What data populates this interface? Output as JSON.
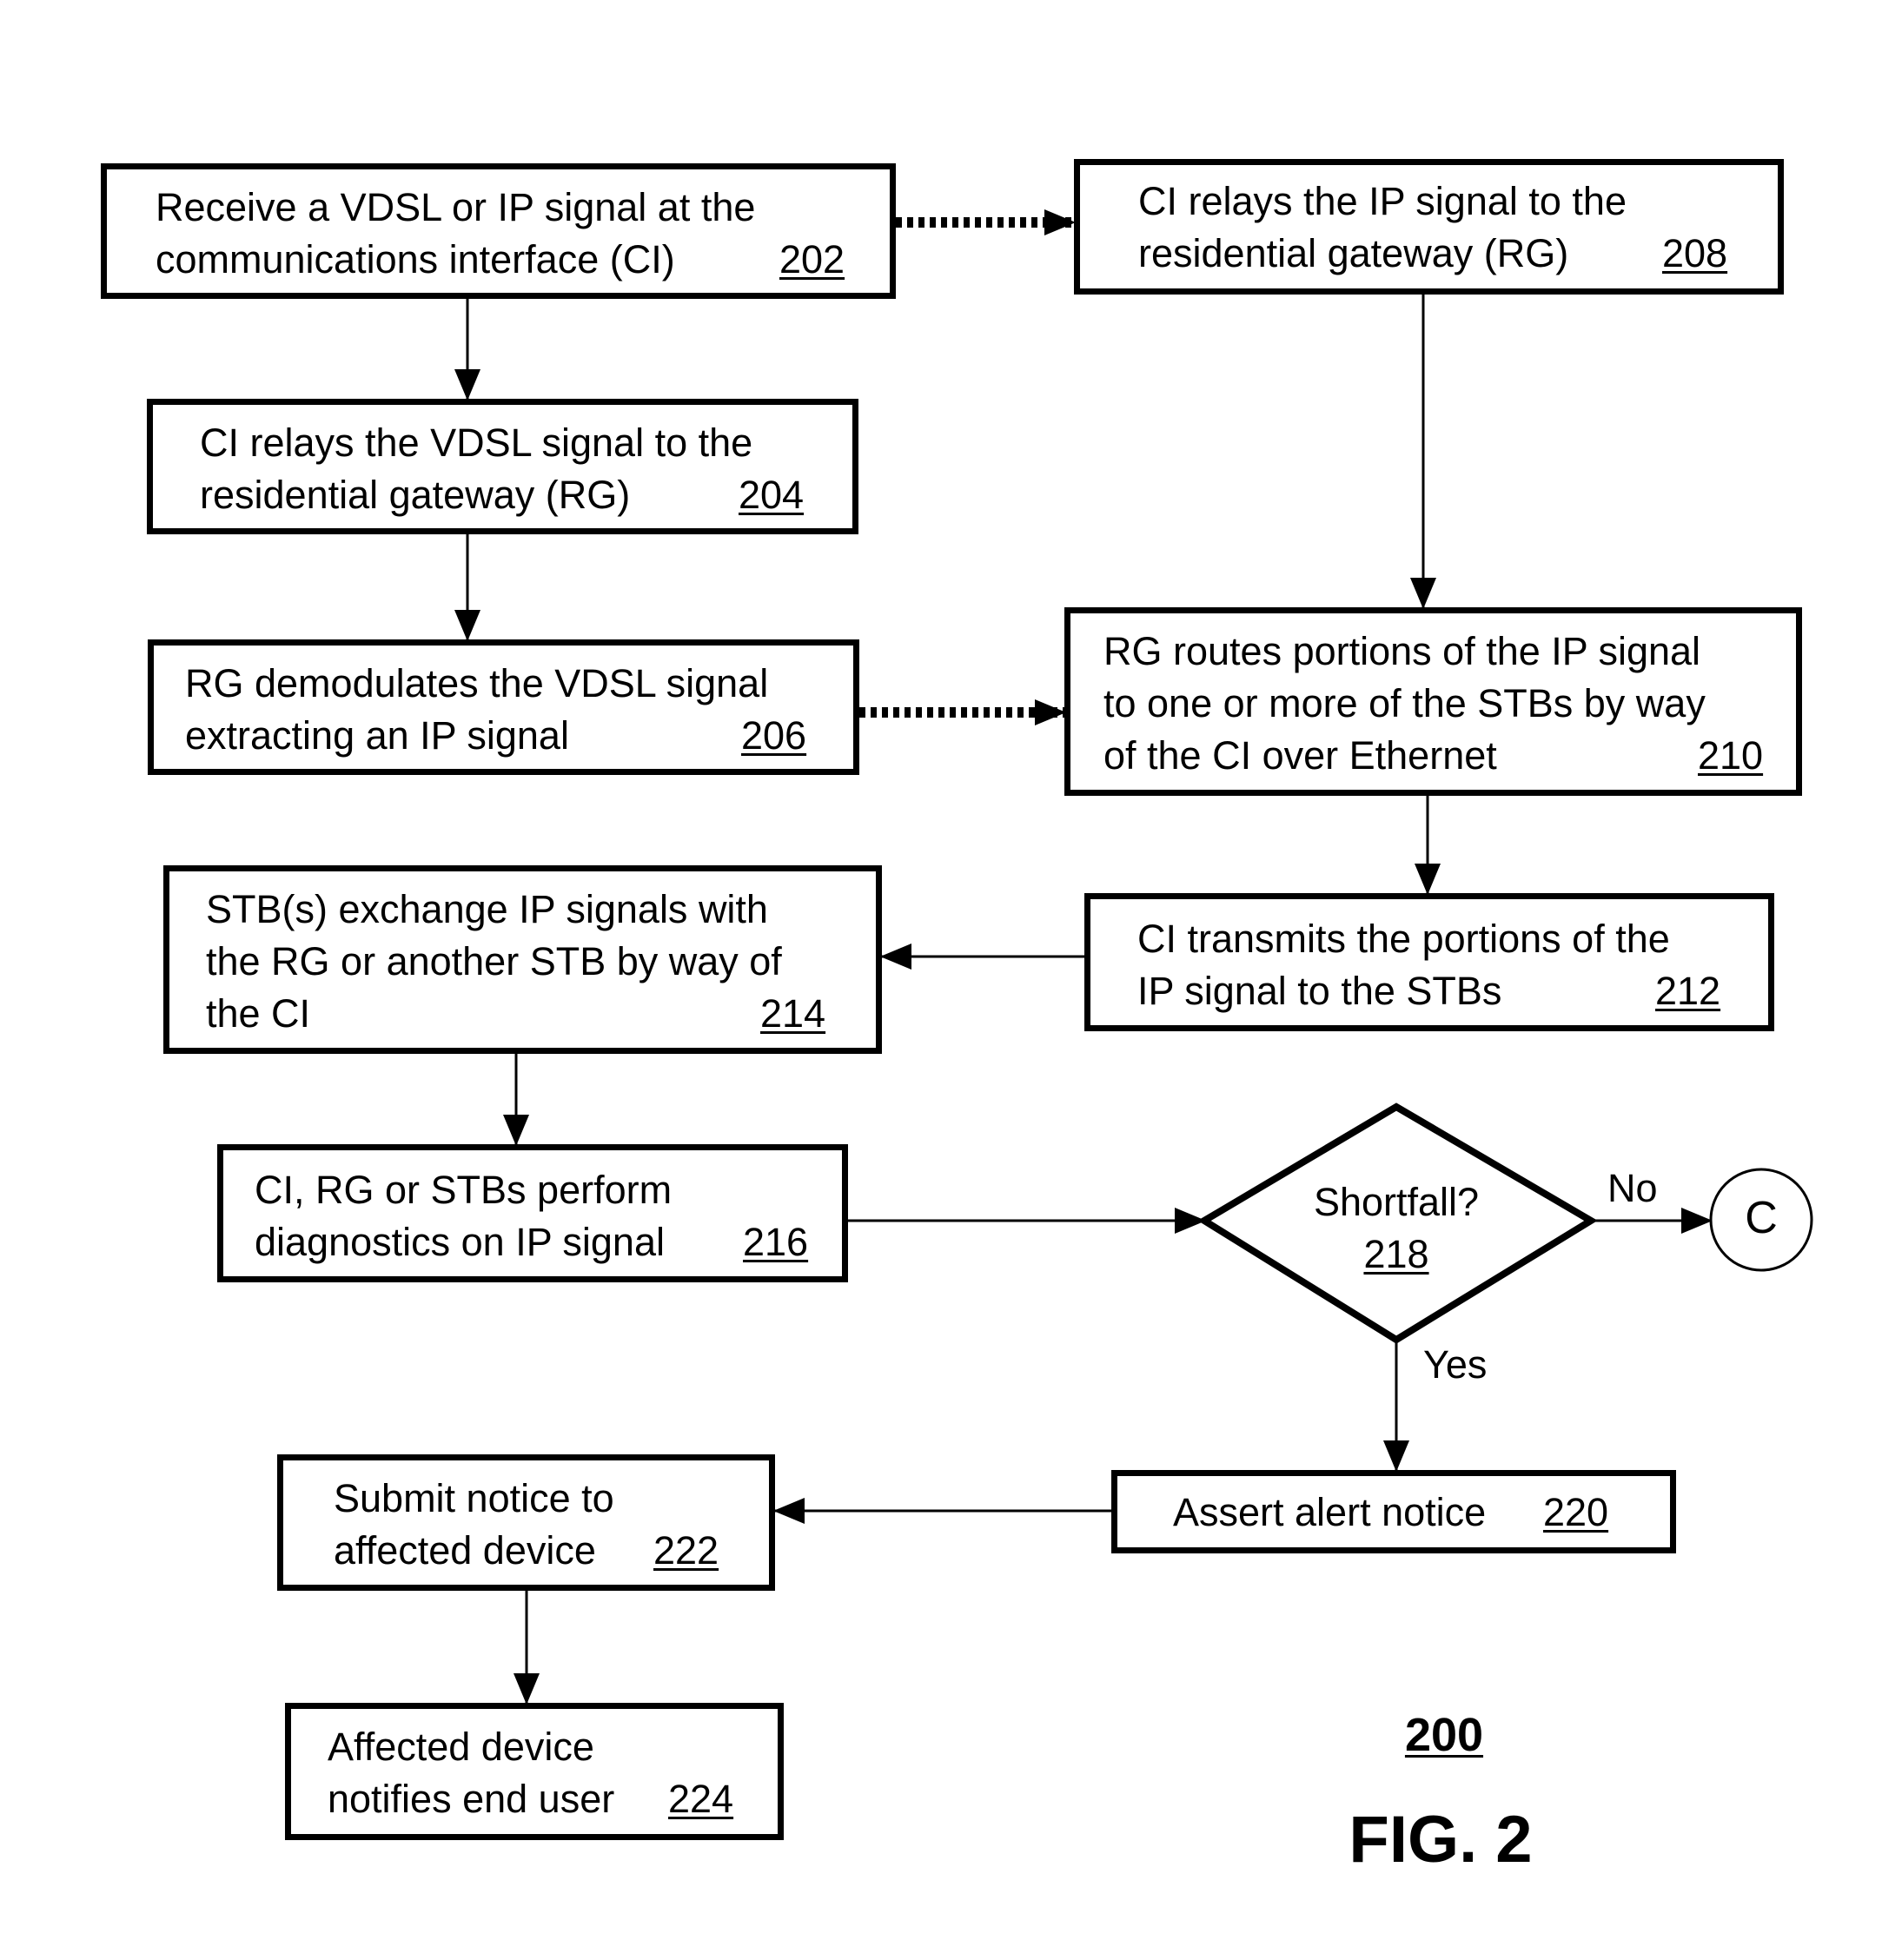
{
  "figure": {
    "number_label": "200",
    "caption": "FIG. 2",
    "colors": {
      "stroke": "#000000",
      "background": "#ffffff"
    }
  },
  "steps": {
    "s202": {
      "lines": [
        "Receive a VDSL or IP signal at the",
        "communications interface (CI)"
      ],
      "ref": "202"
    },
    "s204": {
      "lines": [
        "CI relays the VDSL signal to the",
        "residential gateway (RG)"
      ],
      "ref": "204"
    },
    "s206": {
      "lines": [
        "RG demodulates the VDSL signal",
        "extracting an IP signal"
      ],
      "ref": "206"
    },
    "s208": {
      "lines": [
        "CI relays the IP signal to the",
        "residential gateway (RG)"
      ],
      "ref": "208"
    },
    "s210": {
      "lines": [
        "RG routes portions of the IP signal",
        "to one or more of the STBs by way",
        "of the CI over Ethernet"
      ],
      "ref": "210"
    },
    "s212": {
      "lines": [
        "CI transmits the portions of the",
        "IP signal to the STBs"
      ],
      "ref": "212"
    },
    "s214": {
      "lines": [
        "STB(s) exchange IP signals with",
        "the RG or another STB by way of",
        "the CI"
      ],
      "ref": "214"
    },
    "s216": {
      "lines": [
        "CI, RG or STBs perform",
        "diagnostics on IP signal"
      ],
      "ref": "216"
    },
    "s218": {
      "question": "Shortfall?",
      "ref": "218",
      "no_label": "No",
      "yes_label": "Yes"
    },
    "s220": {
      "lines": [
        "Assert alert notice"
      ],
      "ref": "220"
    },
    "s222": {
      "lines": [
        "Submit notice to",
        "affected device"
      ],
      "ref": "222"
    },
    "s224": {
      "lines": [
        "Affected device",
        "notifies end user"
      ],
      "ref": "224"
    },
    "connector": {
      "label": "C"
    }
  }
}
